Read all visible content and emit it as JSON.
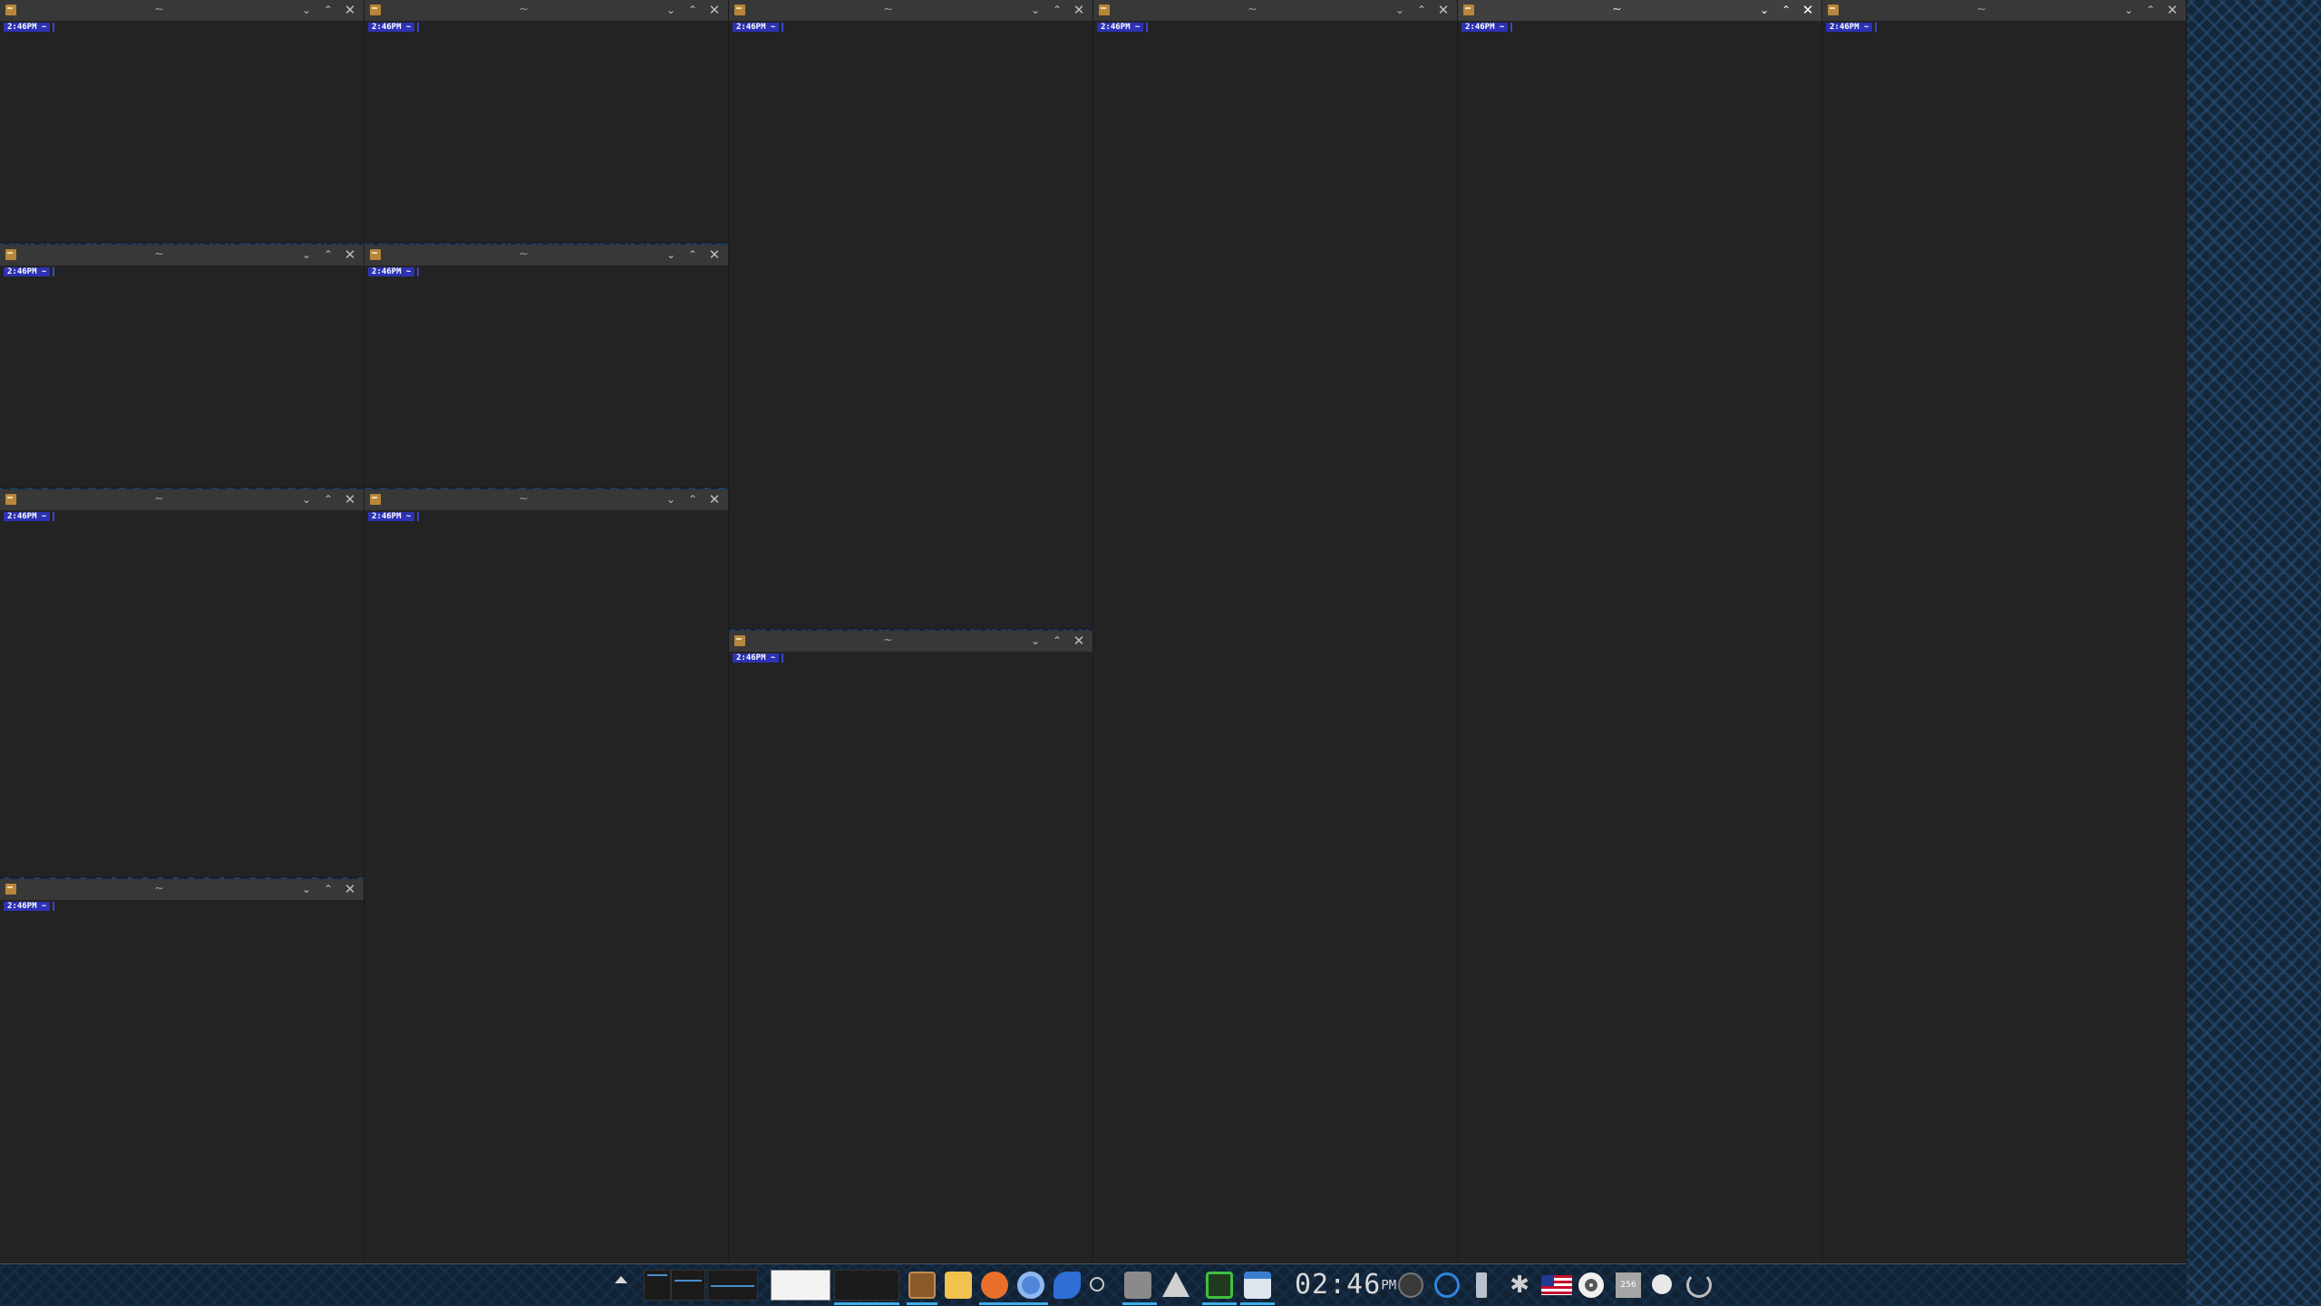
{
  "terminal": {
    "title": "~",
    "prompt": "2:46PM ~",
    "buttons": {
      "minimize": "⌄",
      "maximize": "⌃",
      "close": "✕"
    }
  },
  "taskbar": {
    "clock": {
      "time": "02:46",
      "ampm": "PM"
    },
    "pinned_icons": [
      "terminal-icon",
      "mail-icon",
      "firefox-icon",
      "chromium-icon",
      "rocket-icon",
      "scissors-icon",
      "launcher-icon",
      "arch-icon",
      "activity-monitor-icon",
      "file-manager-icon"
    ],
    "tray_icons": [
      "volume-icon",
      "dialog-icon",
      "usb-icon",
      "bluetooth-icon",
      "us-flag-icon",
      "record-icon",
      "disk-usage-icon",
      "bulb-icon",
      "power-icon"
    ],
    "disk_usage": "256",
    "colors": {
      "accent": "#3daee9",
      "prompt_bg": "#2d32b4",
      "terminal_bg": "#232323",
      "titlebar": "#383838"
    }
  }
}
